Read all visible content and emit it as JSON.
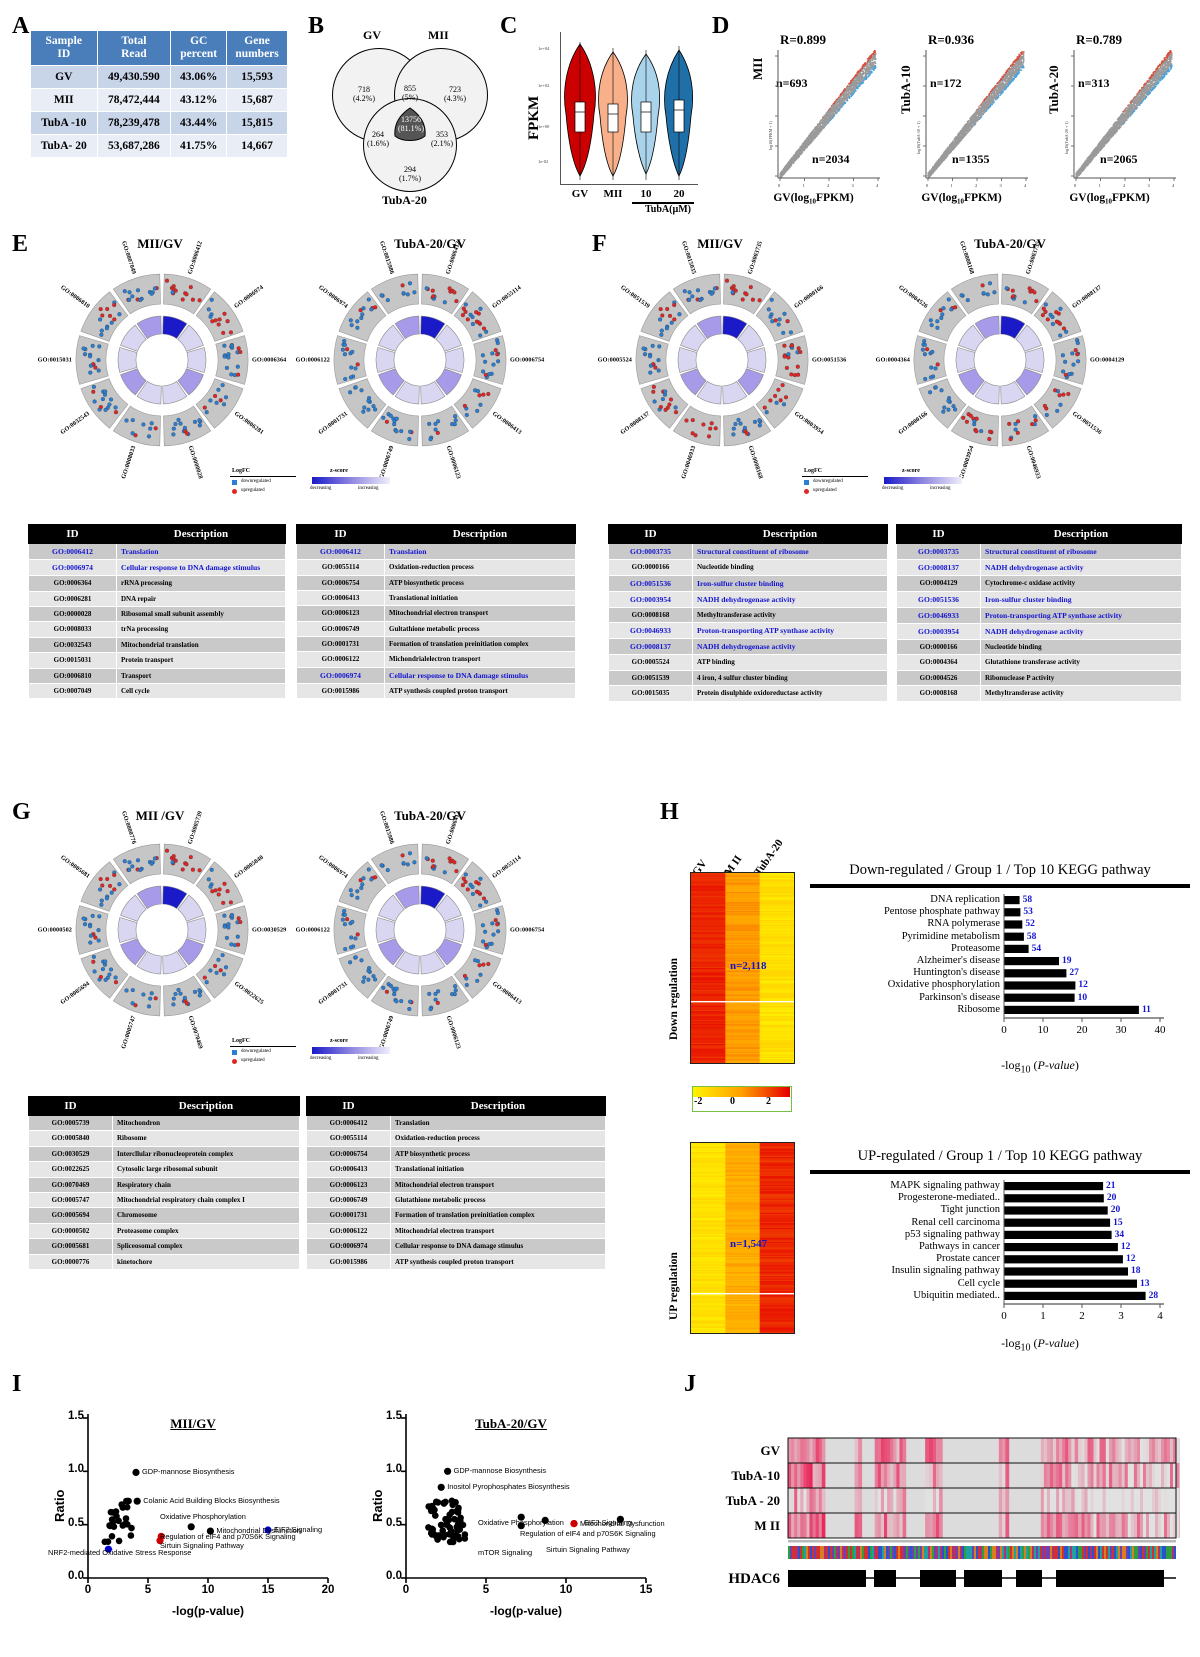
{
  "panels": {
    "A": "A",
    "B": "B",
    "C": "C",
    "D": "D",
    "E": "E",
    "F": "F",
    "G": "G",
    "H": "H",
    "I": "I",
    "J": "J"
  },
  "tableA": {
    "headers": [
      "Sample\nID",
      "Total\nRead",
      "GC\npercent",
      "Gene\nnumbers"
    ],
    "header_lines": [
      [
        "Sample",
        "ID"
      ],
      [
        "Total",
        "Read"
      ],
      [
        "GC",
        "percent"
      ],
      [
        "Gene",
        "numbers"
      ]
    ],
    "rows": [
      [
        "GV",
        "49,430.590",
        "43.06%",
        "15,593"
      ],
      [
        "MII",
        "78,472,444",
        "43.12%",
        "15,687"
      ],
      [
        "TubA -10",
        "78,239,478",
        "43.44%",
        "15,815"
      ],
      [
        "TubA- 20",
        "53,687,286",
        "41.75%",
        "14,667"
      ]
    ],
    "header_bg": "#4a7ebb"
  },
  "venn": {
    "sets": [
      "GV",
      "MII",
      "TubA-20"
    ],
    "regions": [
      {
        "name": "GV-only",
        "count": "718",
        "pct": "(4.2%)"
      },
      {
        "name": "GV-MII",
        "count": "855",
        "pct": "(5%)"
      },
      {
        "name": "MII-only",
        "count": "723",
        "pct": "(4.3%)"
      },
      {
        "name": "GV-TubA20",
        "count": "264",
        "pct": "(1.6%)"
      },
      {
        "name": "center",
        "count": "13756",
        "pct": "(81.1%)"
      },
      {
        "name": "MII-TubA20",
        "count": "353",
        "pct": "(2.1%)"
      },
      {
        "name": "TubA20-only",
        "count": "294",
        "pct": "(1.7%)"
      }
    ]
  },
  "violin": {
    "ylabel": "FPKM",
    "yticks": [
      "1e+04",
      "1e+02",
      "1e+00",
      "1e-02"
    ],
    "categories": [
      "GV",
      "MII",
      "10",
      "20"
    ],
    "group_label": "TubA(µM)",
    "colors": [
      "#cc0000",
      "#f8b08a",
      "#a8d3ea",
      "#1f6fa8"
    ]
  },
  "chart_data": [
    {
      "type": "scatter",
      "id": "D-1",
      "title": "",
      "ylabel": "MII",
      "ylabel_small": "log10(FPKM + 1)",
      "xlabel": "GV(log₁₀FPKM)",
      "R": "R=0.899",
      "n_up": "n=693",
      "n_down": "n=2034",
      "xticks": [
        "0",
        "1",
        "2",
        "3",
        "4"
      ],
      "yticks": [
        "0",
        "1",
        "2",
        "3",
        "4"
      ]
    },
    {
      "type": "scatter",
      "id": "D-2",
      "ylabel": "TubA-10",
      "ylabel_small": "log10(TubA-10 + 1)",
      "xlabel": "GV(log₁₀FPKM)",
      "R": "R=0.936",
      "n_up": "n=172",
      "n_down": "n=1355",
      "xticks": [
        "0",
        "1",
        "2",
        "3",
        "4"
      ],
      "yticks": [
        "0",
        "2",
        "4",
        "6"
      ]
    },
    {
      "type": "scatter",
      "id": "D-3",
      "ylabel": "TubA-20",
      "ylabel_small": "log10(TubA-20 + 1)",
      "xlabel": "GV(log₁₀FPKM)",
      "R": "R=0.789",
      "n_up": "n=313",
      "n_down": "n=2065",
      "xticks": [
        "0",
        "1",
        "2",
        "3",
        "4"
      ],
      "yticks": [
        "0",
        "2",
        "4",
        "6"
      ]
    },
    {
      "type": "bar",
      "id": "H-down",
      "title": "Down-regulated / Group 1 / Top 10 KEGG pathway",
      "xlabel": "-log₁₀ (P-value)",
      "orientation": "horizontal",
      "xlim": [
        0,
        40
      ],
      "xticks": [
        0,
        10,
        20,
        30,
        40
      ],
      "categories": [
        "DNA replication",
        "Pentose phosphate pathway",
        "RNA polymerase",
        "Pyrimidine metabolism",
        "Proteasome",
        "Alzheimer's disease",
        "Huntington's disease",
        "Oxidative phosphorylation",
        "Parkinson's disease",
        "Ribosome"
      ],
      "values": [
        4.0,
        4.2,
        4.7,
        5.1,
        6.3,
        14.1,
        16.0,
        18.3,
        18.1,
        34.6
      ],
      "labels": [
        "58",
        "53",
        "52",
        "58",
        "54",
        "19",
        "27",
        "12",
        "10",
        "11"
      ],
      "n_label": "n=2,118",
      "side_label": "Down regulation"
    },
    {
      "type": "bar",
      "id": "H-up",
      "title": "UP-regulated / Group 1 / Top 10 KEGG pathway",
      "xlabel": "-log₁₀ (P-value)",
      "orientation": "horizontal",
      "xlim": [
        0,
        4
      ],
      "xticks": [
        0,
        1,
        2,
        3,
        4
      ],
      "categories": [
        "MAPK signaling pathway",
        "Progesterone-mediated..",
        "Tight junction",
        "Renal cell carcinoma",
        "p53 signaling pathway",
        "Pathways in cancer",
        "Prostate cancer",
        "Insulin signaling pathway",
        "Cell cycle",
        "Ubiquitin mediated.."
      ],
      "values": [
        2.54,
        2.56,
        2.66,
        2.72,
        2.76,
        2.92,
        3.05,
        3.18,
        3.41,
        3.63
      ],
      "labels": [
        "21",
        "20",
        "20",
        "15",
        "34",
        "12",
        "12",
        "18",
        "13",
        "28"
      ],
      "n_label": "n=1,547",
      "side_label": "UP regulation"
    },
    {
      "type": "scatter",
      "id": "I-1",
      "title": "MII/GV",
      "xlabel": "-log(p-value)",
      "ylabel": "Ratio",
      "xlim": [
        0,
        20
      ],
      "ylim": [
        0,
        1.5
      ],
      "xticks": [
        0,
        5,
        10,
        15,
        20
      ],
      "yticks": [
        "0.0",
        "0.5",
        "1.0",
        "1.5"
      ],
      "annotations": [
        {
          "label": "GDP-mannose Biosynthesis",
          "x": 4.0,
          "y": 0.99,
          "color": "#000000"
        },
        {
          "label": "Colanic Acid Building Blocks Biosynthesis",
          "x": 4.1,
          "y": 0.72,
          "color": "#000000"
        },
        {
          "label": "Oxidative Phosphorylation",
          "x": 8.6,
          "y": 0.48,
          "color": "#000000"
        },
        {
          "label": "Mitochondrial Dysfunction",
          "x": 10.2,
          "y": 0.44,
          "color": "#000000"
        },
        {
          "label": "EIF2 Signaling",
          "x": 15.0,
          "y": 0.45,
          "color": "#0000cc"
        },
        {
          "label": "Regulation of eIF4 and p70S6K Signaling",
          "x": 6.1,
          "y": 0.39,
          "color": "#cc0000"
        },
        {
          "label": "Sirtuin Signaling Pathway",
          "x": 6.0,
          "y": 0.35,
          "color": "#cc0000"
        },
        {
          "label": "NRF2-mediated Oxidative Stress Response",
          "x": 1.7,
          "y": 0.27,
          "color": "#0000cc"
        }
      ]
    },
    {
      "type": "scatter",
      "id": "I-2",
      "title": "TubA-20/GV",
      "xlabel": "-log(p-value)",
      "ylabel": "Ratio",
      "xlim": [
        0,
        15
      ],
      "ylim": [
        0,
        1.5
      ],
      "xticks": [
        0,
        5,
        10,
        15
      ],
      "yticks": [
        "0.0",
        "0.5",
        "1.0",
        "1.5"
      ],
      "annotations": [
        {
          "label": "GDP-mannose Biosynthesis",
          "x": 2.6,
          "y": 1.0,
          "color": "#000000"
        },
        {
          "label": "Inositol Pyrophosphates Biosynthesis",
          "x": 2.2,
          "y": 0.85,
          "color": "#000000"
        },
        {
          "label": "Oxidative Phosphorylation",
          "x": 7.2,
          "y": 0.57,
          "color": "#000000"
        },
        {
          "label": "EIF2 Signaling",
          "x": 13.4,
          "y": 0.55,
          "color": "#000000"
        },
        {
          "label": "Regulation of eIF4 and p70S6K Signaling",
          "x": 8.7,
          "y": 0.54,
          "color": "#000000"
        },
        {
          "label": "Mitochondrial Dysfunction",
          "x": 10.5,
          "y": 0.51,
          "color": "#cc0000"
        },
        {
          "label": "mTOR Signaling",
          "x": 7.2,
          "y": 0.49,
          "color": "#000000"
        },
        {
          "label": "Sirtuin Signaling Pathway",
          "x": 10.5,
          "y": 0.51,
          "color": "#cc0000"
        }
      ]
    }
  ],
  "circos": {
    "E": {
      "left_title": "MII/GV",
      "right_title": "TubA-20/GV",
      "left_terms": [
        "GO:0006412",
        "GO:0006974",
        "GO:0006364",
        "GO:0006281",
        "GO:0000028",
        "GO:0008033",
        "GO:0032543",
        "GO:0015031",
        "GO:0006810",
        "GO:0007049"
      ],
      "right_terms": [
        "GO:0006412",
        "GO:0055114",
        "GO:0006754",
        "GO:0006413",
        "GO:0006123",
        "GO:0006749",
        "GO:0001731",
        "GO:0006122",
        "GO:0006974",
        "GO:0015986"
      ]
    },
    "F": {
      "left_title": "MII/GV",
      "right_title": "TubA-20/GV",
      "left_terms": [
        "GO:0003735",
        "GO:0000166",
        "GO:0051536",
        "GO:0003954",
        "GO:0008168",
        "GO:0046933",
        "GO:0008137",
        "GO:0005524",
        "GO:0051539",
        "GO:0015035"
      ],
      "right_terms": [
        "GO:0003735",
        "GO:0008137",
        "GO:0004129",
        "GO:0051536",
        "GO:0046933",
        "GO:0003954",
        "GO:0000166",
        "GO:0004364",
        "GO:0004526",
        "GO:0008168"
      ]
    },
    "G": {
      "left_title": "MII /GV",
      "right_title": "TubA-20/GV",
      "left_terms": [
        "GO:0005739",
        "GO:0005840",
        "GO:0030529",
        "GO:0022625",
        "GO:0070469",
        "GO:0005747",
        "GO:0005694",
        "GO:0000502",
        "GO:0005681",
        "GO:0000776"
      ],
      "right_terms": [
        "GO:0006412",
        "GO:0055114",
        "GO:0006754",
        "GO:0006413",
        "GO:0006123",
        "GO:0006749",
        "GO:0001731",
        "GO:0006122",
        "GO:0006974",
        "GO:0015986"
      ]
    },
    "legend": {
      "logfc_title": "LogFC",
      "down": "downregulated",
      "up": "upregulated",
      "zscore_title": "z-score",
      "decreasing": "decreasing",
      "increasing": "increasing"
    }
  },
  "gotables": {
    "headers": {
      "id": "ID",
      "desc": "Description"
    },
    "E_left": [
      {
        "id": "GO:0006412",
        "desc": "Translation",
        "hl": true
      },
      {
        "id": "GO:0006974",
        "desc": "Cellular response to DNA damage stimulus",
        "hl": true
      },
      {
        "id": "GO:0006364",
        "desc": "rRNA processing",
        "hl": false
      },
      {
        "id": "GO:0006281",
        "desc": "DNA  repair",
        "hl": false
      },
      {
        "id": "GO:0000028",
        "desc": "Ribosomal small subunit assembly",
        "hl": false
      },
      {
        "id": "GO:0008033",
        "desc": "trNa processing",
        "hl": false
      },
      {
        "id": "GO:0032543",
        "desc": "Mitochondrial  translation",
        "hl": false
      },
      {
        "id": "GO:0015031",
        "desc": "Protein transport",
        "hl": false
      },
      {
        "id": "GO:0006810",
        "desc": "Transport",
        "hl": false
      },
      {
        "id": "GO:0007049",
        "desc": "Cell cycle",
        "hl": false
      }
    ],
    "E_right": [
      {
        "id": "GO:0006412",
        "desc": "Translation",
        "hl": true
      },
      {
        "id": "GO:0055114",
        "desc": "Oxidation-reduction process",
        "hl": false
      },
      {
        "id": "GO:0006754",
        "desc": "ATP biosynthetic process",
        "hl": false
      },
      {
        "id": "GO:0006413",
        "desc": "Translational initiation",
        "hl": false
      },
      {
        "id": "GO:0006123",
        "desc": "Mitochondrial electron transport",
        "hl": false
      },
      {
        "id": "GO:0006749",
        "desc": "Gultathione metabolic process",
        "hl": false
      },
      {
        "id": "GO:0001731",
        "desc": "Formation of translation preinitiation complex",
        "hl": false
      },
      {
        "id": "GO:0006122",
        "desc": "Michondrialelectron transport",
        "hl": false
      },
      {
        "id": "GO:0006974",
        "desc": "Cellular response to DNA damage stimulus",
        "hl": true
      },
      {
        "id": "GO:0015986",
        "desc": "ATP synthesis coupled proton transport",
        "hl": false
      }
    ],
    "F_left": [
      {
        "id": "GO:0003735",
        "desc": "Structural constituent of ribosome",
        "hl": true
      },
      {
        "id": "GO:0000166",
        "desc": "Nucleotide binding",
        "hl": false
      },
      {
        "id": "GO:0051536",
        "desc": "Iron-sulfur cluster binding",
        "hl": true
      },
      {
        "id": "GO:0003954",
        "desc": "NADH dehydrogenase activity",
        "hl": true
      },
      {
        "id": "GO:0008168",
        "desc": "Methyltransferase activity",
        "hl": false
      },
      {
        "id": "GO:0046933",
        "desc": "Proton-transporting ATP synthase activity",
        "hl": true
      },
      {
        "id": "GO:0008137",
        "desc": "NADH dehydrogenase activity",
        "hl": true
      },
      {
        "id": "GO:0005524",
        "desc": "ATP binding",
        "hl": false
      },
      {
        "id": "GO:0051539",
        "desc": "4 iron, 4 sulfur cluster binding",
        "hl": false
      },
      {
        "id": "GO:0015035",
        "desc": "Protein disulphide oxidoreductase activity",
        "hl": false
      }
    ],
    "F_right": [
      {
        "id": "GO:0003735",
        "desc": "Structural constituent of ribosome",
        "hl": true
      },
      {
        "id": "GO:0008137",
        "desc": "NADH dehydrogenase activity",
        "hl": true
      },
      {
        "id": "GO:0004129",
        "desc": "Cytochrome-c oxidase activity",
        "hl": false
      },
      {
        "id": "GO:0051536",
        "desc": "Iron-sulfur cluster binding",
        "hl": true
      },
      {
        "id": "GO:0046933",
        "desc": "Proton-transporting ATP synthase activity",
        "hl": true
      },
      {
        "id": "GO:0003954",
        "desc": "NADH dehydrogenase activity",
        "hl": true
      },
      {
        "id": "GO:0000166",
        "desc": "Nucleotide binding",
        "hl": false
      },
      {
        "id": "GO:0004364",
        "desc": "Glutathione transferase activity",
        "hl": false
      },
      {
        "id": "GO:0004526",
        "desc": "Ribonuclease P activity",
        "hl": false
      },
      {
        "id": "GO:0008168",
        "desc": "Methyltransferase activity",
        "hl": false
      }
    ],
    "G_left": [
      {
        "id": "GO:0005739",
        "desc": "Mitochondron",
        "hl": false
      },
      {
        "id": "GO:0005840",
        "desc": "Ribosome",
        "hl": false
      },
      {
        "id": "GO:0030529",
        "desc": "Intercllular ribonucleoprotein complex",
        "hl": false
      },
      {
        "id": "GO:0022625",
        "desc": "Cytosolic large ribosomal subunit",
        "hl": false
      },
      {
        "id": "GO:0070469",
        "desc": "Respiratory chain",
        "hl": false
      },
      {
        "id": "GO:0005747",
        "desc": "Mitochondrial respiratory chain complex I",
        "hl": false
      },
      {
        "id": "GO:0005694",
        "desc": "Chromosome",
        "hl": false
      },
      {
        "id": "GO:0000502",
        "desc": "Proteasome complex",
        "hl": false
      },
      {
        "id": "GO:0005681",
        "desc": "Spliceosomal complex",
        "hl": false
      },
      {
        "id": "GO:0000776",
        "desc": "kinetochore",
        "hl": false
      }
    ],
    "G_right": [
      {
        "id": "GO:0006412",
        "desc": "Translation",
        "hl": false
      },
      {
        "id": "GO:0055114",
        "desc": "Oxidation-reduction process",
        "hl": false
      },
      {
        "id": "GO:0006754",
        "desc": "ATP biosynthetic process",
        "hl": false
      },
      {
        "id": "GO:0006413",
        "desc": "Translational initiation",
        "hl": false
      },
      {
        "id": "GO:0006123",
        "desc": "Mitochondrial electron transport",
        "hl": false
      },
      {
        "id": "GO:0006749",
        "desc": "Glutathione metabolic process",
        "hl": false
      },
      {
        "id": "GO:0001731",
        "desc": "Formation of translation preinitiation complex",
        "hl": false
      },
      {
        "id": "GO:0006122",
        "desc": "Mitochondrial electron transport",
        "hl": false
      },
      {
        "id": "GO:0006974",
        "desc": "Cellular response to DNA damage stimulus",
        "hl": false
      },
      {
        "id": "GO:0015986",
        "desc": "ATP synthesis coupled proton transport",
        "hl": false
      }
    ]
  },
  "heatmapH": {
    "columns": [
      "GV",
      "M II",
      "TubA-20"
    ],
    "scale_ticks": [
      "-2",
      "0",
      "2"
    ],
    "down_n": "n=2,118",
    "up_n": "n=1,547",
    "down_side": "Down regulation",
    "up_side": "UP regulation"
  },
  "panelJ": {
    "rows": [
      "GV",
      "TubA-10",
      "TubA - 20",
      "M II"
    ],
    "gene": "HDAC6"
  }
}
